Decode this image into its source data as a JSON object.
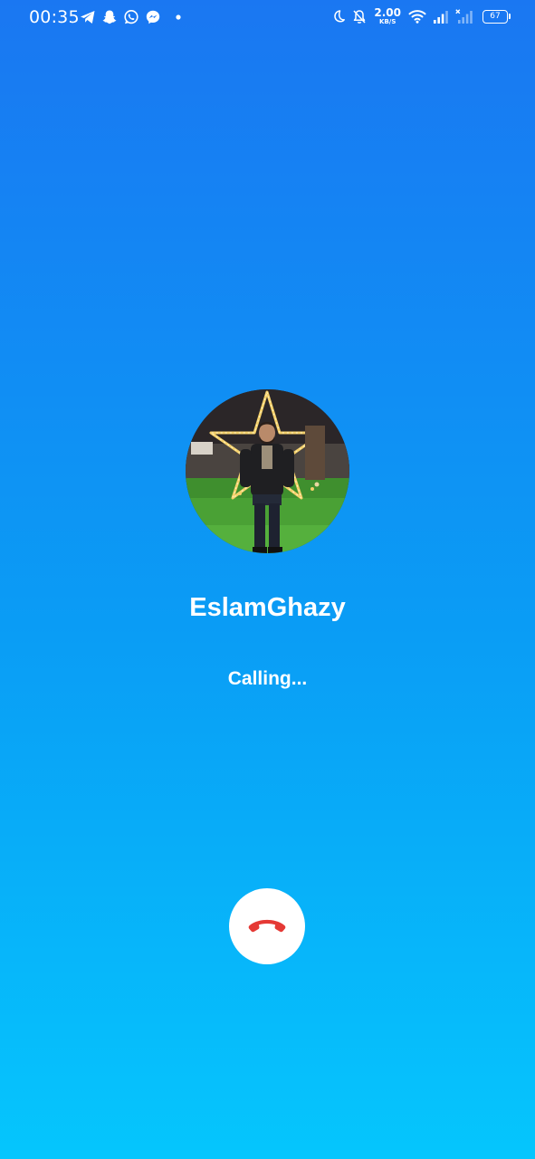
{
  "status_bar": {
    "time": "00:35",
    "notification_icons": [
      "telegram-icon",
      "snapchat-icon",
      "whatsapp-icon",
      "messenger-icon",
      "more-notifications-dot-icon"
    ],
    "net_speed_value": "2.00",
    "net_speed_unit": "KB/S",
    "battery_level": "67",
    "system_icons": [
      "do-not-disturb-moon-icon",
      "notifications-muted-icon",
      "wifi-icon",
      "signal-icon",
      "signal-no-service-icon",
      "battery-icon"
    ]
  },
  "call": {
    "caller_name": "EslamGhazy",
    "status_text": "Calling...",
    "avatar_icon": "caller-avatar-photo",
    "end_call_icon": "phone-hangup-icon"
  },
  "colors": {
    "background_top": "#1a77f2",
    "background_bottom": "#05c6fd",
    "hangup_icon": "#e53935",
    "hangup_button": "#ffffff",
    "text": "#ffffff"
  }
}
